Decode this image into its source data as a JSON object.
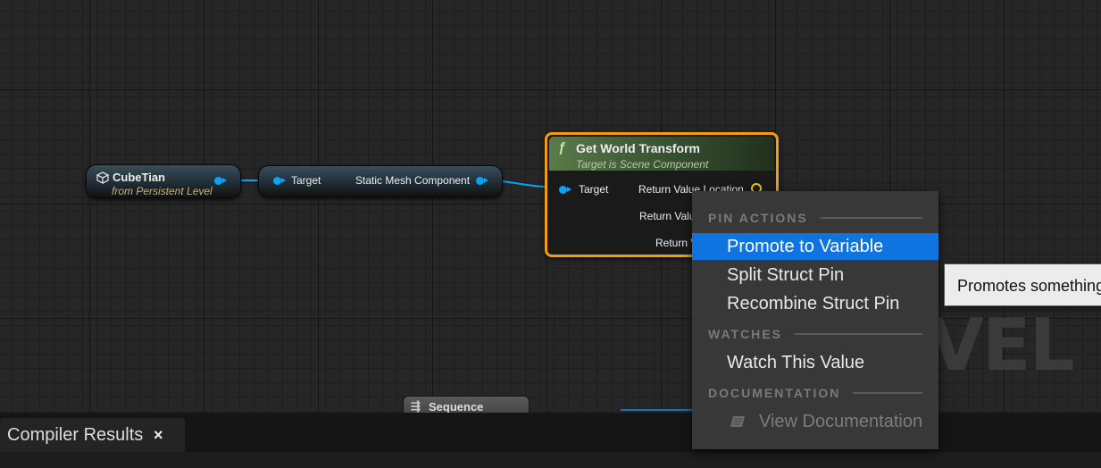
{
  "graph": {
    "watermark": "VEL E",
    "nodes": {
      "cube": {
        "title": "CubeTian",
        "subtitle": "from Persistent Level",
        "icon": "cube-icon"
      },
      "component": {
        "input_label": "Target",
        "output_label": "Static Mesh Component"
      },
      "function": {
        "title": "Get World Transform",
        "subtitle": "Target is Scene Component",
        "icon": "function-icon",
        "input_label": "Target",
        "outputs": [
          "Return Value Location",
          "Return Valu",
          "Return V"
        ]
      },
      "sequence": {
        "title": "Sequence",
        "icon": "sequence-icon"
      }
    },
    "colors": {
      "object_pin": "#0aa2f4",
      "vector_pin": "#f4c20d",
      "selection": "#f39c12",
      "menu_highlight": "#0f73e0"
    }
  },
  "context_menu": {
    "sections": [
      {
        "heading": "PIN ACTIONS",
        "items": [
          {
            "label": "Promote to Variable",
            "highlighted": true
          },
          {
            "label": "Split Struct Pin"
          },
          {
            "label": "Recombine Struct Pin"
          }
        ]
      },
      {
        "heading": "WATCHES",
        "items": [
          {
            "label": "Watch This Value"
          }
        ]
      },
      {
        "heading": "DOCUMENTATION",
        "items": [
          {
            "label": "View Documentation",
            "disabled": true,
            "icon": "documentation-icon"
          }
        ]
      }
    ]
  },
  "tooltip": {
    "text": "Promotes something"
  },
  "bottom_panel": {
    "tab_label": "Compiler Results",
    "close_glyph": "×"
  }
}
